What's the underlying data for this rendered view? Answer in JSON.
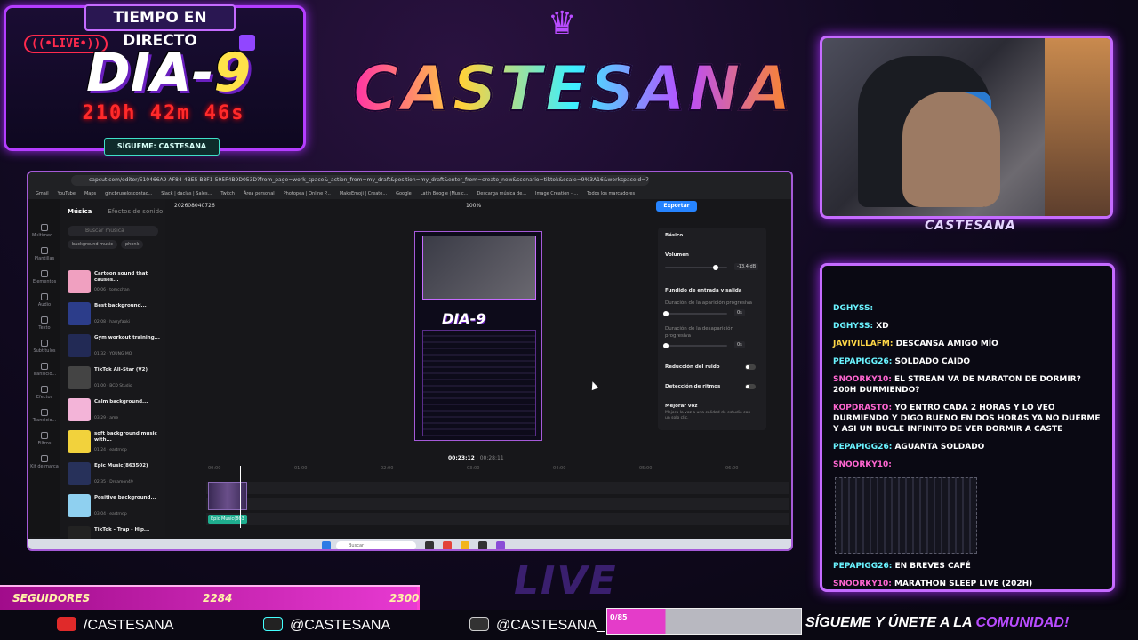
{
  "overlay": {
    "header": "TIEMPO EN DIRECTO",
    "live_badge": "((•LIVE•))",
    "day_prefix": "DIA-",
    "day_number": "9",
    "timer": "210h 42m 46s",
    "follow_cta": "SÍGUEME: CASTESANA",
    "logo_text": "CASTESANA",
    "webcam_name": "CASTESANA"
  },
  "chat": {
    "messages": [
      {
        "user": "DGHYSS:",
        "text": "",
        "color": "cyan"
      },
      {
        "user": "DGHYSS:",
        "text": "XD",
        "color": "cyan"
      },
      {
        "user": "JAVIVILLAFM:",
        "text": "DESCANSA AMIGO MÍO",
        "color": "yellow"
      },
      {
        "user": "PEPAPIGG26:",
        "text": "SOLDADO CAIDO",
        "color": "cyan"
      },
      {
        "user": "SNOORKY10:",
        "text": "EL STREAM VA DE MARATON DE DORMIR? 200H DURMIENDO?",
        "color": "pink"
      },
      {
        "user": "KOPDRASTO:",
        "text": "YO ENTRO CADA 2 HORAS Y LO VEO DURMIENDO Y DIGO BUENO EN DOS HORAS YA NO DUERME Y ASI UN BUCLE INFINITO DE VER DORMIR A CASTE",
        "color": "pink"
      },
      {
        "user": "PEPAPIGG26:",
        "text": "AGUANTA SOLDADO",
        "color": "cyan"
      },
      {
        "user": "SNOORKY10:",
        "text": "",
        "color": "pink"
      },
      {
        "user": "PEPAPIGG26:",
        "text": "EN BREVES CAFÉ",
        "color": "cyan"
      },
      {
        "user": "SNOORKY10:",
        "text": "MARATHON SLEEP LIVE (202H)",
        "color": "pink"
      }
    ]
  },
  "browser": {
    "url": "capcut.com/editor/E10466A9-AF84-4BE5-B8F1-595F4B9D053D?from_page=work_space&_action_from=my_draft&position=my_draft&enter_from=create_new&scenario=tiktok&scale=9%3A16&workspaceId=7323504956072...",
    "bookmarks": [
      "Gmail",
      "YouTube",
      "Maps",
      "gincbruseloscontac...",
      "Slack | daclas | Sales...",
      "Twitch",
      "Área personal",
      "Photopea | Online P...",
      "MakeEmoji | Create...",
      "Google",
      "Latin Boogie (Music...",
      "Descarga música de...",
      "Image Creation - ...",
      "Todos los marcadores"
    ]
  },
  "capcut": {
    "rail_items": [
      "Multimed...",
      "Plantillas",
      "Elementos",
      "Audio",
      "Texto",
      "Subtítulos",
      "Transicio...",
      "Efectos",
      "Transicio...",
      "Filtros",
      "Kit de marca"
    ],
    "tabs": {
      "music": "Música",
      "sfx": "Efectos de sonido"
    },
    "search_placeholder": "Buscar música",
    "chips": [
      "background music",
      "phonk"
    ],
    "tracks": [
      {
        "name": "Cartoon sound that causes...",
        "meta": "00:06 · tomcchan",
        "color": "#f0a0c0"
      },
      {
        "name": "Best background...",
        "meta": "02:08 · harryfaoki",
        "color": "#2c3d8a"
      },
      {
        "name": "Gym workout training...",
        "meta": "01:32 · YOUNG MO",
        "color": "#222a55"
      },
      {
        "name": "TikTok All-Star (V2)",
        "meta": "01:00 · BCD Studio",
        "color": "#444"
      },
      {
        "name": "Calm background...",
        "meta": "03:29 · ame",
        "color": "#f3b4d8"
      },
      {
        "name": "soft background music with...",
        "meta": "01:24 · eartrndp",
        "color": "#f2d23c"
      },
      {
        "name": "Epic Music(863502)",
        "meta": "02:35 · Dreamon49",
        "color": "#27315a"
      },
      {
        "name": "Positive background...",
        "meta": "03:04 · eartrndp",
        "color": "#8fd0f0"
      },
      {
        "name": "TikTok - Trap - Hip...",
        "meta": "",
        "color": "#222"
      }
    ],
    "project_name": "202608040726",
    "zoom": "100%",
    "export_label": "Exportar",
    "props": {
      "section": "Básico",
      "volume_label": "Volumen",
      "volume_value": "-13.4 dB",
      "volume_level": 0.82,
      "fade_label": "Fundido de entrada y salida",
      "fade_in_label": "Duración de la aparición progresiva",
      "fade_in_value": "0s",
      "fade_out_label": "Duración de la desaparición progresiva",
      "fade_out_value": "0s",
      "noise_label": "Reducción del ruido",
      "beat_label": "Detección de ritmos",
      "voice_label": "Mejorar voz",
      "voice_desc": "Mejora la voz a una calidad de estudio con un solo clic."
    },
    "timeline": {
      "current": "00:23:12",
      "total": "00:28:11",
      "ticks": [
        "00:00",
        "01:00",
        "02:00",
        "03:00",
        "04:00",
        "05:00",
        "06:00"
      ],
      "audio_clip": "Epic Music(863"
    },
    "preview": {
      "day": "DIA-9"
    }
  },
  "taskbar": {
    "search": "Buscar"
  },
  "bottom": {
    "followers_label": "SEGUIDORES",
    "followers_count": "2284",
    "followers_goal": "2300",
    "followers_progress": 0.993,
    "youtube": "/CASTESANA",
    "tiktok": "@CASTESANA",
    "instagram": "@CASTESANA_",
    "sub_count": "0/85",
    "cta_prefix": "SÍGUEME Y ÚNETE A LA ",
    "cta_highlight": "COMUNIDAD!",
    "live_deco": "LIVE"
  }
}
